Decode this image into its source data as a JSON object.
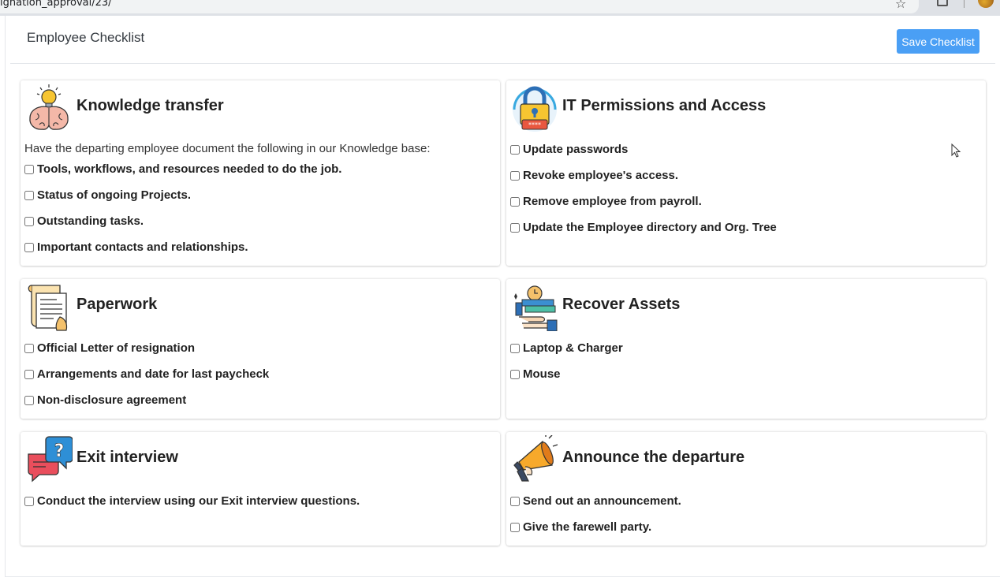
{
  "browser": {
    "url": "ignation_approval/23/"
  },
  "header": {
    "title": "Employee Checklist",
    "save_label": "Save Checklist"
  },
  "sections": [
    {
      "title": "Knowledge transfer",
      "icon": "brain-lightbulb-icon",
      "description": "Have the departing employee document the following in our Knowledge base:",
      "items": [
        "Tools, workflows, and resources needed to do the job.",
        "Status of ongoing Projects.",
        "Outstanding tasks.",
        "Important contacts and relationships."
      ]
    },
    {
      "title": "IT Permissions and Access",
      "icon": "padlock-password-icon",
      "items": [
        "Update passwords",
        "Revoke employee's access.",
        "Remove employee from payroll.",
        "Update the Employee directory and Org. Tree"
      ]
    },
    {
      "title": "Paperwork",
      "icon": "document-scroll-icon",
      "items": [
        "Official Letter of resignation",
        "Arrangements and date for last paycheck",
        "Non-disclosure agreement"
      ]
    },
    {
      "title": "Recover Assets",
      "icon": "assets-return-icon",
      "items": [
        "Laptop & Charger",
        "Mouse"
      ]
    },
    {
      "title": "Exit interview",
      "icon": "question-chat-bubbles-icon",
      "items": [
        "Conduct the interview using our Exit interview questions."
      ]
    },
    {
      "title": "Announce the departure",
      "icon": "megaphone-icon",
      "items": [
        "Send out an announcement.",
        "Give the farewell party."
      ]
    }
  ],
  "colors": {
    "accent": "#4a9ff5",
    "border": "#e3e6ea"
  }
}
